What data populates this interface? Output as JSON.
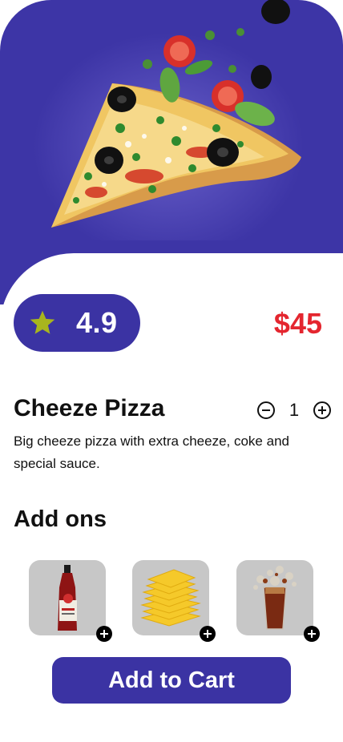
{
  "colors": {
    "brand": "#3b33a3",
    "price": "#e4262f",
    "star": "#a8b51e",
    "addon_bg": "#c7c7c7"
  },
  "hero": {
    "image": "pizza-slice-with-flying-toppings"
  },
  "rating": {
    "icon": "star-icon",
    "value": "4.9"
  },
  "price": "$45",
  "product": {
    "name": "Cheeze Pizza",
    "description": "Big cheeze pizza with extra cheeze, coke and special sauce.",
    "quantity": "1",
    "decrease_icon": "minus-circle-icon",
    "increase_icon": "plus-circle-icon"
  },
  "addons": {
    "title": "Add ons",
    "items": [
      {
        "image": "ketchup-bottle",
        "action_icon": "plus-icon"
      },
      {
        "image": "cheese-slices",
        "action_icon": "plus-icon"
      },
      {
        "image": "cola-glass",
        "action_icon": "plus-icon"
      }
    ]
  },
  "cart_button": {
    "label": "Add to Cart"
  }
}
